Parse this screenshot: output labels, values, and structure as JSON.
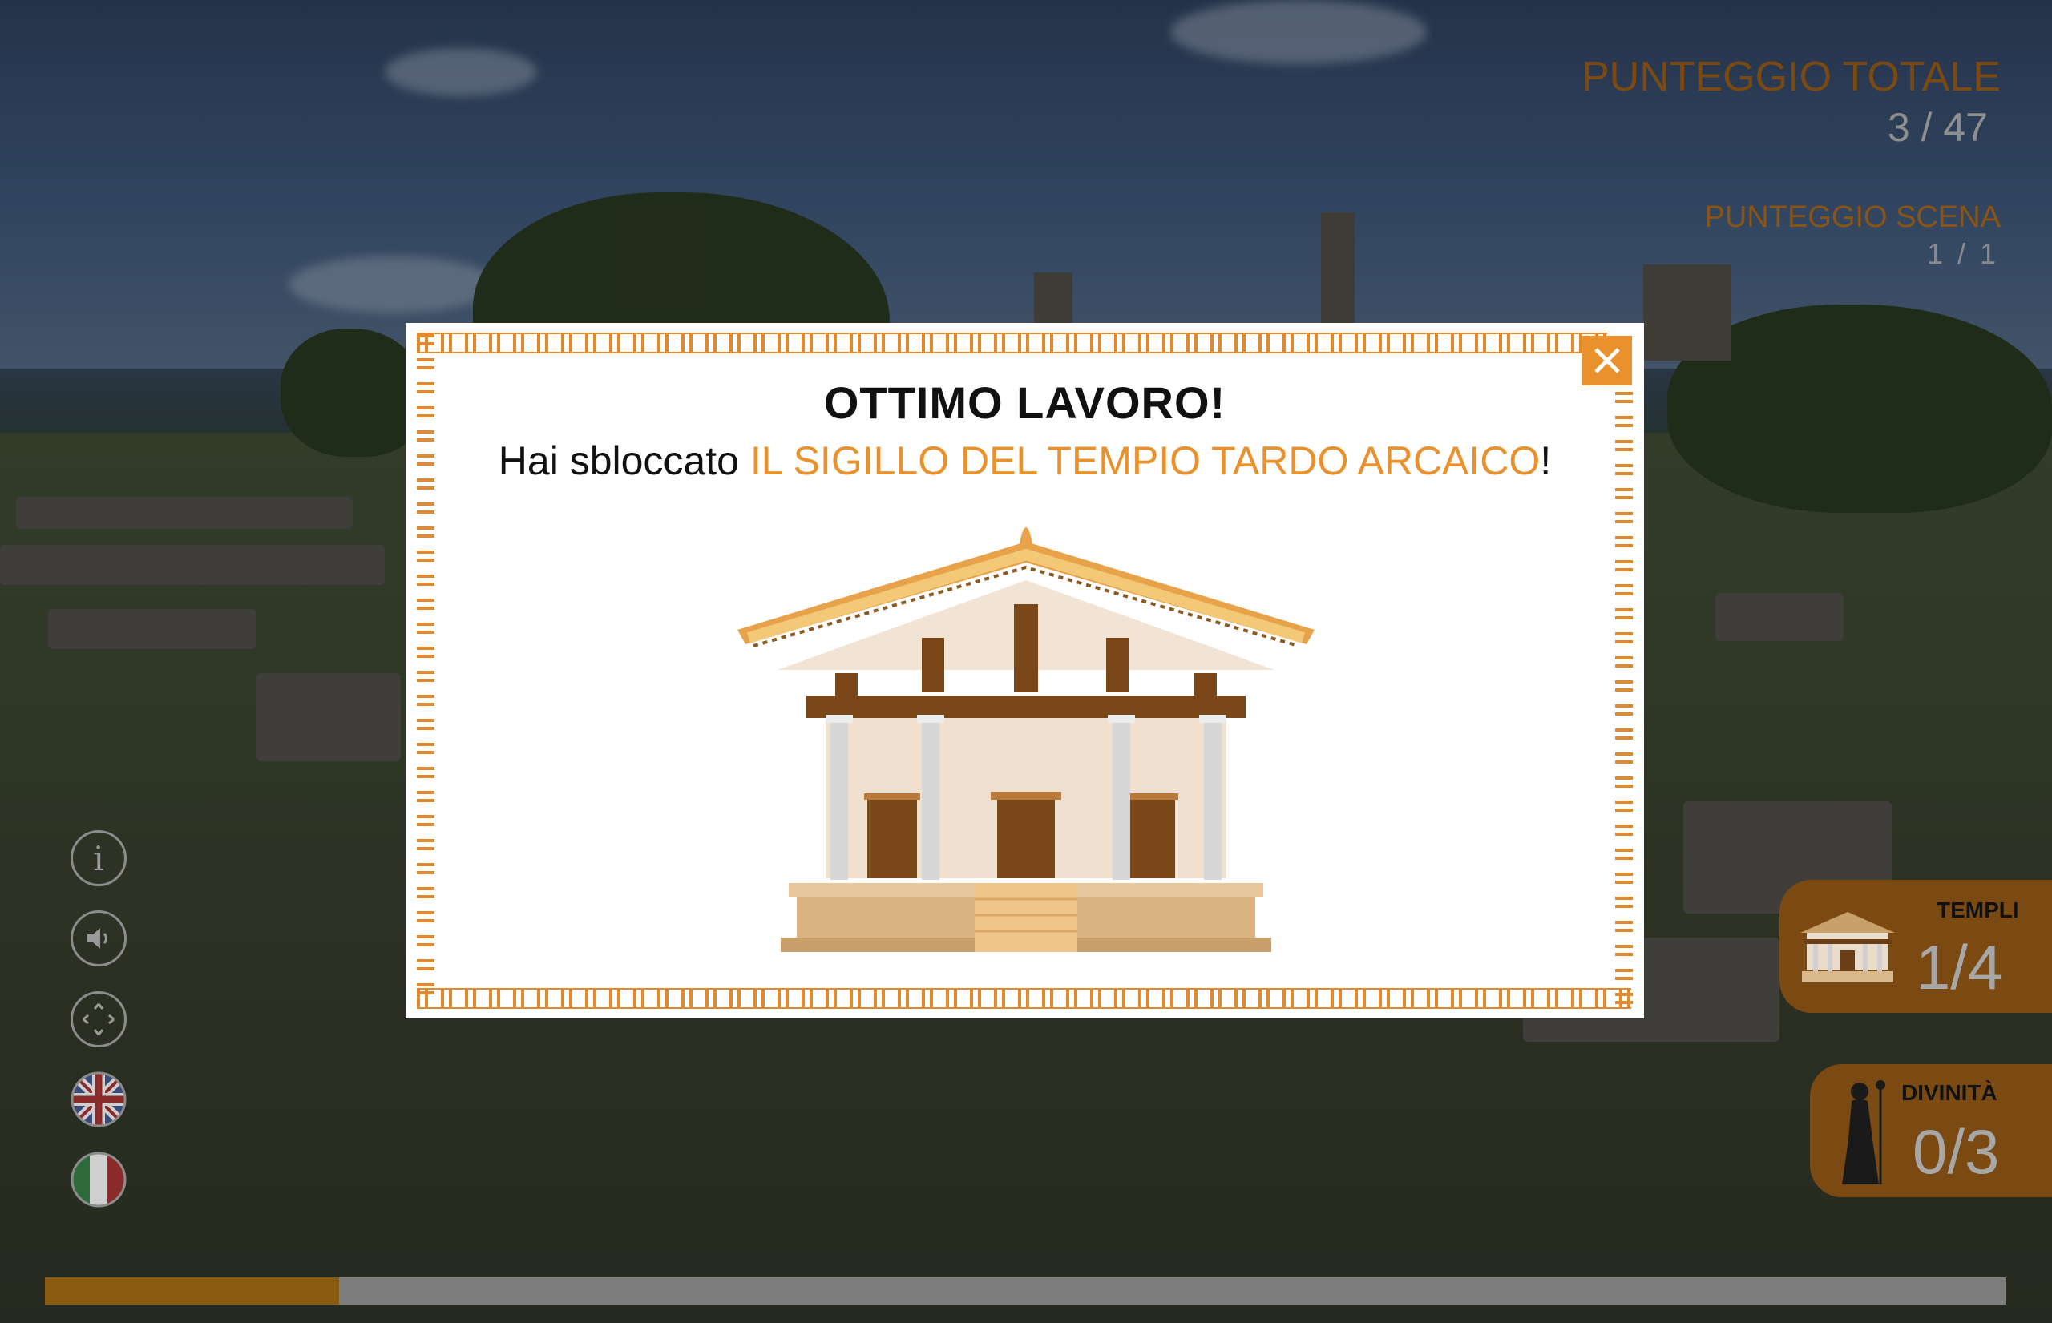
{
  "score": {
    "total_title": "PUNTEGGIO TOTALE",
    "total_value": "3 / 47",
    "scene_title": "PUNTEGGIO SCENA",
    "scene_value": "1 / 1"
  },
  "side_buttons": [
    {
      "icon": "info-icon",
      "glyph": "i"
    },
    {
      "icon": "audio-icon",
      "glyph": "◖)"
    },
    {
      "icon": "move-icon",
      "glyph": "✥"
    },
    {
      "icon": "english-flag-icon"
    },
    {
      "icon": "italian-flag-icon"
    }
  ],
  "progress": {
    "value": 0.15
  },
  "counters": {
    "templi": {
      "label": "TEMPLI",
      "value": "1/4"
    },
    "divinita": {
      "label": "DIVINITÀ",
      "value": "0/3"
    }
  },
  "modal": {
    "title": "OTTIMO LAVORO!",
    "sub_before": "Hai sbloccato ",
    "sub_highlight": "IL SIGILLO DEL TEMPIO TARDO ARCAICO",
    "sub_after": "!"
  },
  "colors": {
    "accent": "#e8912d",
    "brand_brown": "#7b4a12"
  }
}
